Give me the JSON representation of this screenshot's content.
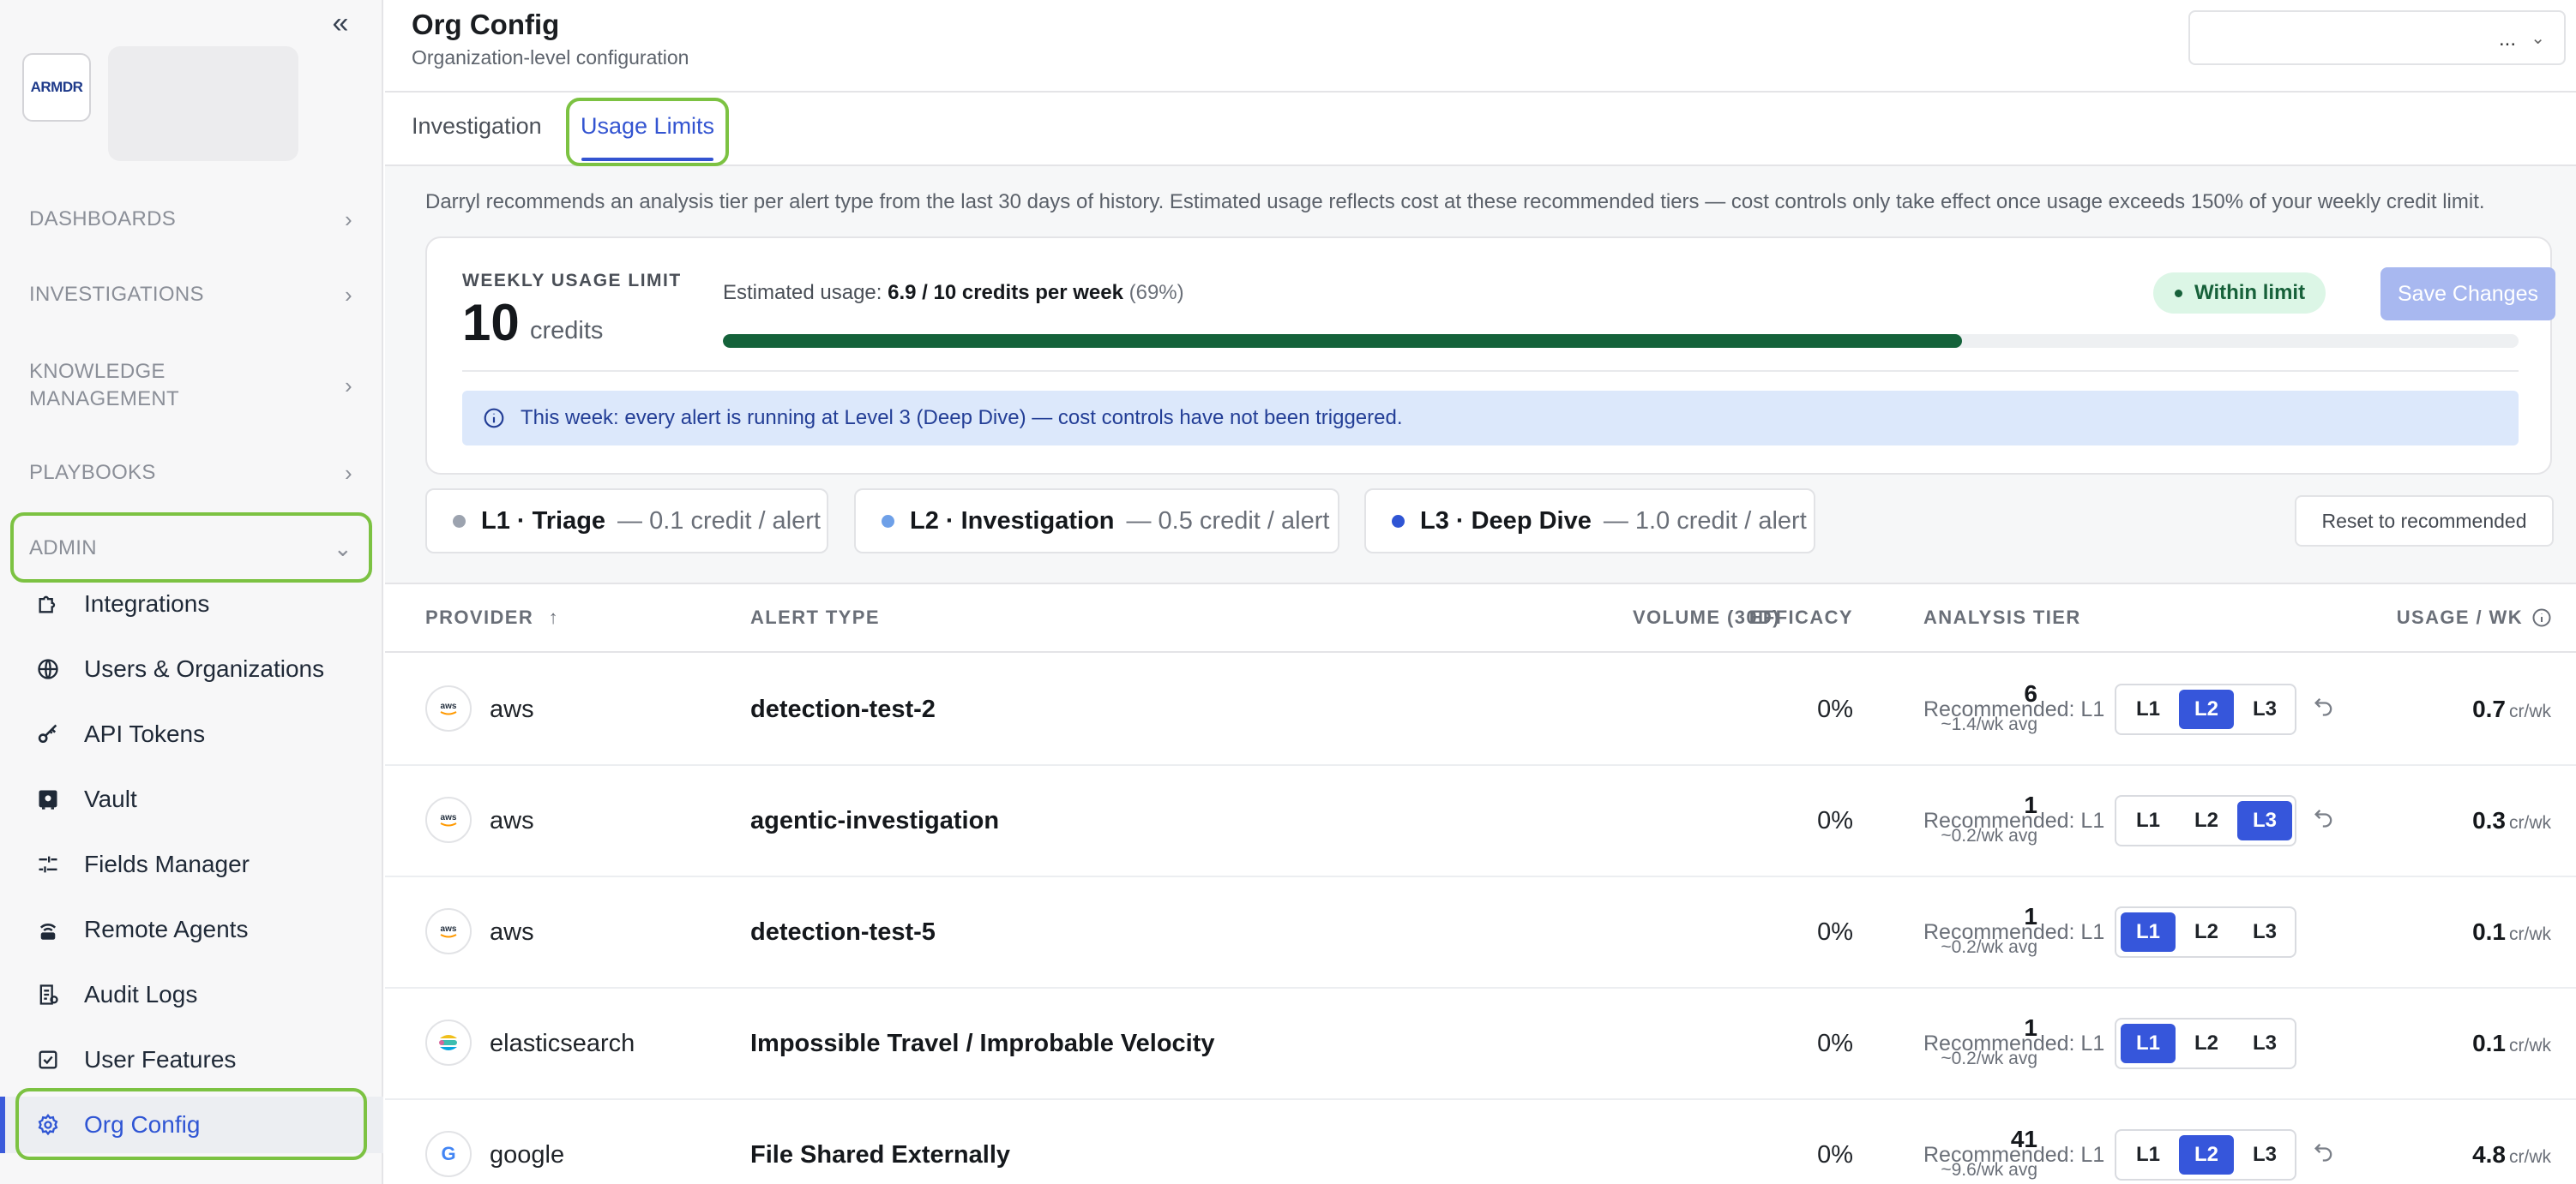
{
  "sidebar": {
    "logo_text": "ARMDR",
    "sections": [
      "DASHBOARDS",
      "INVESTIGATIONS",
      "KNOWLEDGE MANAGEMENT",
      "PLAYBOOKS",
      "ADMIN"
    ],
    "items": [
      {
        "label": "Integrations",
        "icon": "puzzle-icon"
      },
      {
        "label": "Users & Organizations",
        "icon": "globe-icon"
      },
      {
        "label": "API Tokens",
        "icon": "key-icon"
      },
      {
        "label": "Vault",
        "icon": "vault-icon"
      },
      {
        "label": "Fields Manager",
        "icon": "sliders-icon"
      },
      {
        "label": "Remote Agents",
        "icon": "remote-icon"
      },
      {
        "label": "Audit Logs",
        "icon": "log-icon"
      },
      {
        "label": "User Features",
        "icon": "checkbox-icon"
      },
      {
        "label": "Org Config",
        "icon": "gear-icon"
      }
    ]
  },
  "header": {
    "title": "Org Config",
    "subtitle": "Organization-level configuration",
    "selector_value": "..."
  },
  "tabs": [
    {
      "label": "Investigation"
    },
    {
      "label": "Usage Limits"
    }
  ],
  "description": "Darryl recommends an analysis tier per alert type from the last 30 days of history. Estimated usage reflects cost at these recommended tiers — cost controls only take effect once usage exceeds 150% of your weekly credit limit.",
  "limit": {
    "label": "WEEKLY USAGE LIMIT",
    "value": "10",
    "unit": "credits",
    "estimate_prefix": "Estimated usage:",
    "estimate_value": "6.9 / 10 credits per week",
    "estimate_pct": "(69%)",
    "progress_fraction": 0.69,
    "status": "Within limit",
    "save_label": "Save Changes",
    "info": "This week: every alert is running at Level 3 (Deep Dive) — cost controls have not been triggered."
  },
  "tiers": [
    {
      "name": "L1 · Triage",
      "cost": "— 0.1 credit / alert",
      "color": "#9ca3af"
    },
    {
      "name": "L2 · Investigation",
      "cost": "— 0.5 credit / alert",
      "color": "#6ea0e8"
    },
    {
      "name": "L3 · Deep Dive",
      "cost": "— 1.0 credit / alert",
      "color": "#2f55d4"
    }
  ],
  "reset_label": "Reset to recommended",
  "table": {
    "headers": {
      "provider": "PROVIDER",
      "alert_type": "ALERT TYPE",
      "volume": "VOLUME (30D)",
      "efficacy": "EFFICACY",
      "tier": "ANALYSIS TIER",
      "usage": "USAGE / WK"
    },
    "tier_labels": [
      "L1",
      "L2",
      "L3"
    ],
    "usage_unit": "cr/wk",
    "rows": [
      {
        "provider": "aws",
        "alert_type": "detection-test-2",
        "volume": "6",
        "volume_sub": "~1.4/wk avg",
        "efficacy": "0%",
        "recommended": "Recommended: L1",
        "selected": "L2",
        "usage": "0.7"
      },
      {
        "provider": "aws",
        "alert_type": "agentic-investigation",
        "volume": "1",
        "volume_sub": "~0.2/wk avg",
        "efficacy": "0%",
        "recommended": "Recommended: L1",
        "selected": "L3",
        "usage": "0.3"
      },
      {
        "provider": "aws",
        "alert_type": "detection-test-5",
        "volume": "1",
        "volume_sub": "~0.2/wk avg",
        "efficacy": "0%",
        "recommended": "Recommended: L1",
        "selected": "L1",
        "usage": "0.1"
      },
      {
        "provider": "elasticsearch",
        "alert_type": "Impossible Travel / Improbable Velocity",
        "volume": "1",
        "volume_sub": "~0.2/wk avg",
        "efficacy": "0%",
        "recommended": "Recommended: L1",
        "selected": "L1",
        "usage": "0.1"
      },
      {
        "provider": "google",
        "alert_type": "File Shared Externally",
        "volume": "41",
        "volume_sub": "~9.6/wk avg",
        "efficacy": "0%",
        "recommended": "Recommended: L1",
        "selected": "L2",
        "usage": "4.8"
      }
    ]
  }
}
